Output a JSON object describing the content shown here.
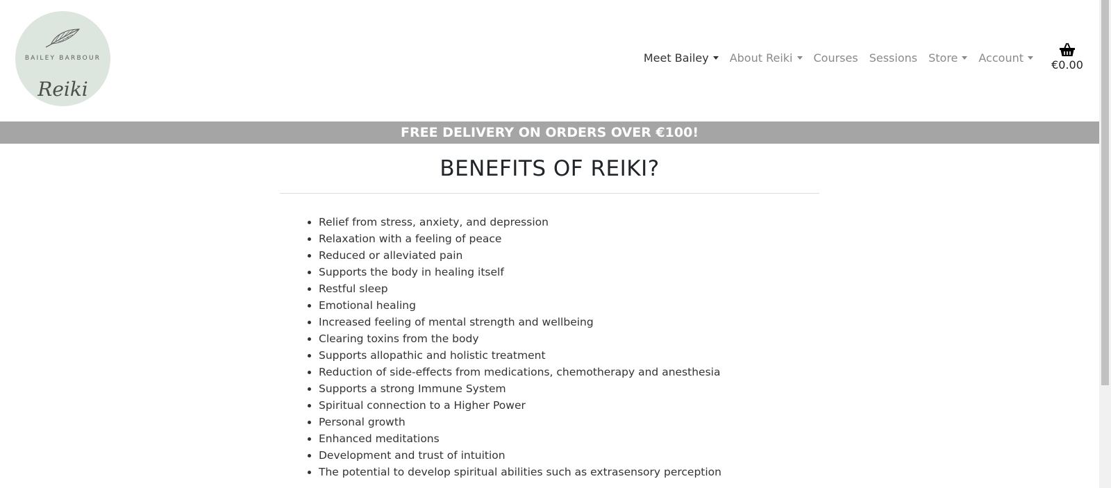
{
  "logo": {
    "brand_top": "BAILEY BARBOUR",
    "brand_script": "Reiki",
    "icon": "feather-icon"
  },
  "nav": {
    "items": [
      {
        "label": "Meet Bailey",
        "dropdown": true,
        "active": true
      },
      {
        "label": "About Reiki",
        "dropdown": true
      },
      {
        "label": "Courses",
        "dropdown": false
      },
      {
        "label": "Sessions",
        "dropdown": false
      },
      {
        "label": "Store",
        "dropdown": true
      },
      {
        "label": "Account",
        "dropdown": true
      }
    ],
    "cart": {
      "icon": "basket-icon",
      "total": "€0.00"
    }
  },
  "banner": {
    "text": "FREE DELIVERY ON ORDERS OVER €100!"
  },
  "main": {
    "title": "BENEFITS OF REIKI?",
    "benefits": [
      "Relief from stress, anxiety, and depression",
      "Relaxation with a feeling of peace",
      "Reduced or alleviated pain",
      "Supports the body in healing itself",
      "Restful sleep",
      "Emotional healing",
      "Increased feeling of mental strength and wellbeing",
      "Clearing toxins from the body",
      "Supports allopathic and holistic treatment",
      "Reduction of side-effects from medications, chemotherapy and anesthesia",
      "Supports a strong Immune System",
      "Spiritual connection to a Higher Power",
      "Personal growth",
      "Enhanced meditations",
      "Development and trust of intuition",
      "The potential to develop spiritual abilities such as extrasensory perception"
    ]
  },
  "colors": {
    "banner_bg": "#a5a5a5",
    "logo_bg": "#dde5df",
    "nav_text": "#8a8a8a",
    "nav_active": "#333333"
  }
}
